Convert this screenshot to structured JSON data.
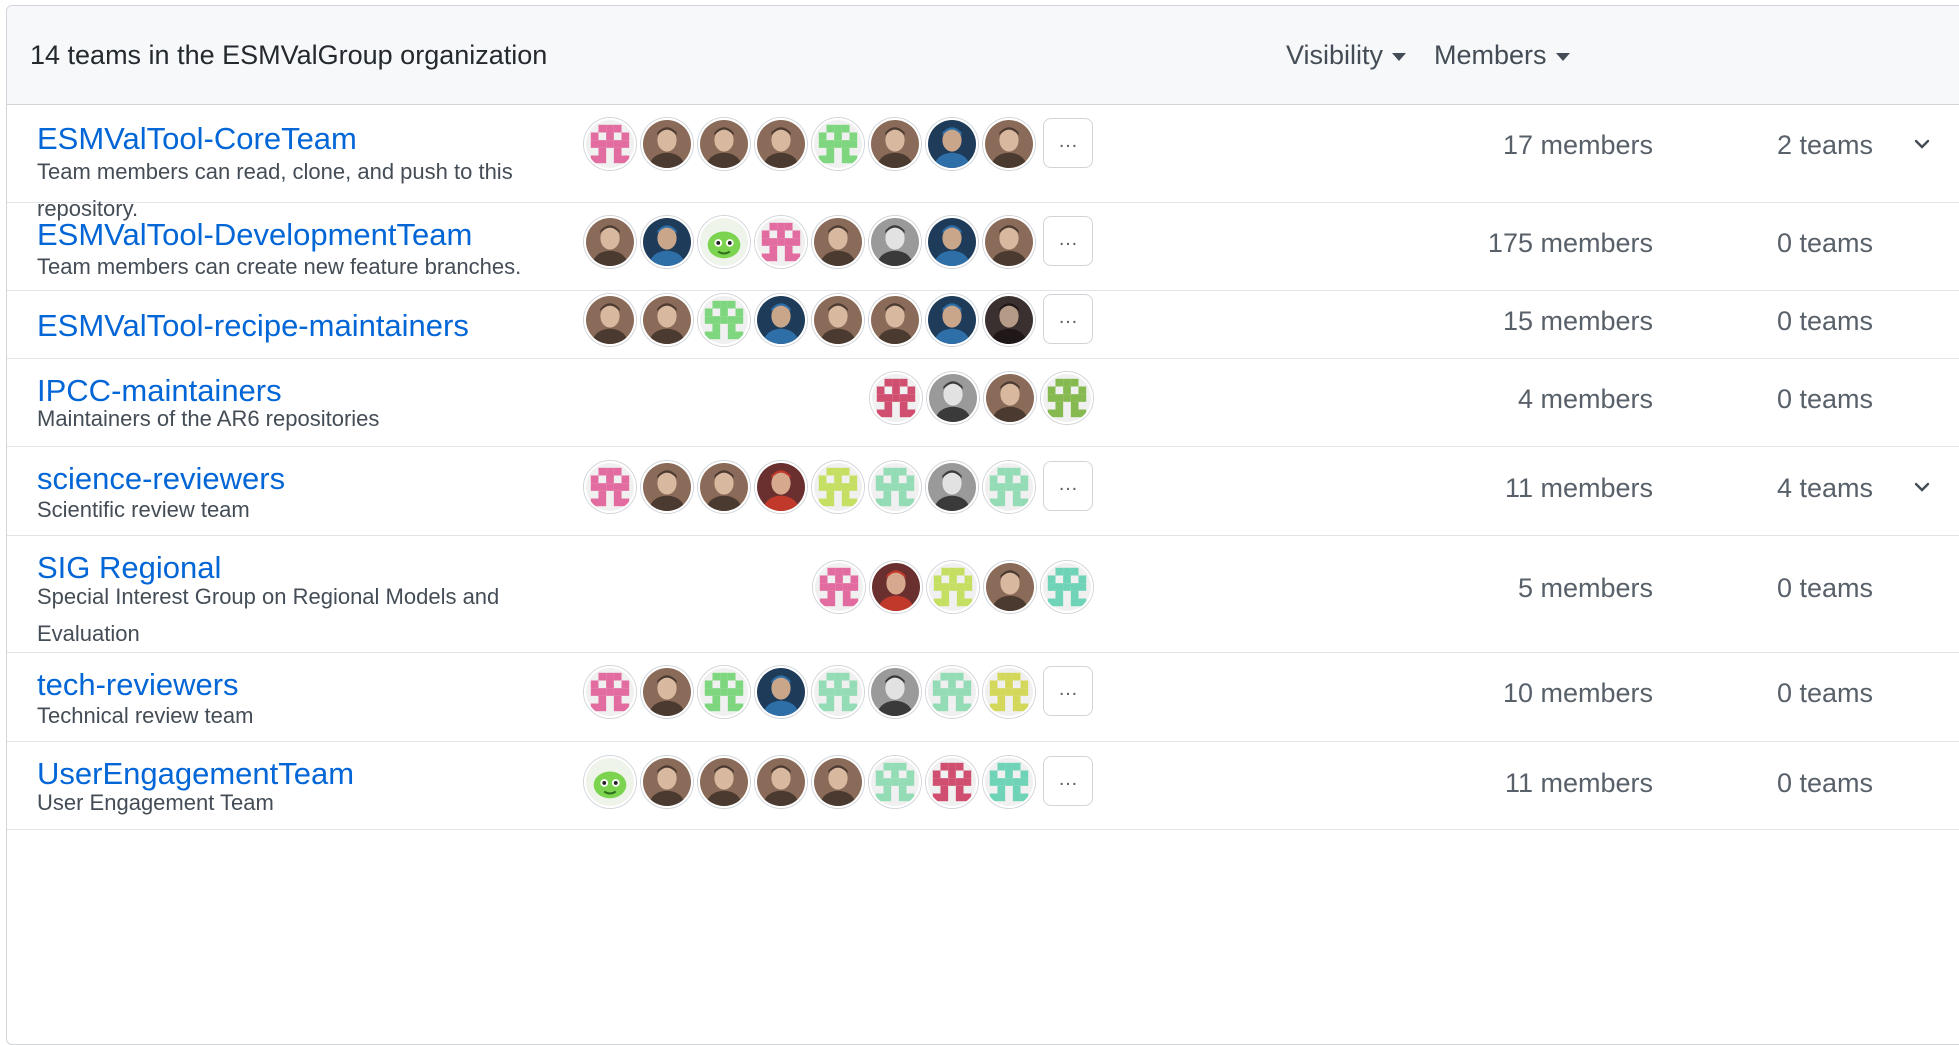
{
  "header": {
    "title": "14 teams in the ESMValGroup organization",
    "visibility_label": "Visibility",
    "members_label": "Members"
  },
  "colors": {
    "link": "#0366d6",
    "muted": "#586069",
    "border": "#d1d5da",
    "header_bg": "#f6f8fa"
  },
  "more_label": "…",
  "teams": [
    {
      "name": "ESMValTool-CoreTeam",
      "description": "Team members can read, clone, and push to this repository.",
      "members": "17 members",
      "teams": "2 teams",
      "expandable": true,
      "avatars": [
        "identicon-pink",
        "photo",
        "photo",
        "photo",
        "identicon-green",
        "photo",
        "photo-blue",
        "photo"
      ],
      "more": true
    },
    {
      "name": "ESMValTool-DevelopmentTeam",
      "description": "Team members can create new feature branches.",
      "members": "175 members",
      "teams": "0 teams",
      "expandable": false,
      "avatars": [
        "photo",
        "photo-blue",
        "cartoon-green",
        "identicon-pink",
        "photo",
        "photo-gray",
        "photo-blue",
        "photo"
      ],
      "more": true
    },
    {
      "name": "ESMValTool-recipe-maintainers",
      "description": "",
      "members": "15 members",
      "teams": "0 teams",
      "expandable": false,
      "avatars": [
        "photo",
        "photo",
        "identicon-green",
        "photo-blue",
        "photo",
        "photo",
        "photo-blue",
        "photo-dark"
      ],
      "more": true
    },
    {
      "name": "IPCC-maintainers",
      "description": "Maintainers of the AR6 repositories",
      "members": "4 members",
      "teams": "0 teams",
      "expandable": false,
      "avatars": [
        "identicon-red",
        "photo-gray",
        "photo",
        "identicon-olive"
      ],
      "more": false
    },
    {
      "name": "science-reviewers",
      "description": "Scientific review team",
      "members": "11 members",
      "teams": "4 teams",
      "expandable": true,
      "avatars": [
        "identicon-pink",
        "photo",
        "photo",
        "photo-red",
        "identicon-lime",
        "identicon-mint",
        "photo-gray",
        "identicon-mint"
      ],
      "more": true
    },
    {
      "name": "SIG Regional",
      "description": "Special Interest Group on Regional Models and Evaluation",
      "members": "5 members",
      "teams": "0 teams",
      "expandable": false,
      "avatars": [
        "identicon-pink",
        "photo-red",
        "identicon-lime",
        "photo",
        "identicon-teal"
      ],
      "more": false
    },
    {
      "name": "tech-reviewers",
      "description": "Technical review team",
      "members": "10 members",
      "teams": "0 teams",
      "expandable": false,
      "avatars": [
        "identicon-pink",
        "photo",
        "identicon-green",
        "photo-blue",
        "identicon-mint",
        "photo-gray",
        "identicon-mint",
        "identicon-yellow"
      ],
      "more": true
    },
    {
      "name": "UserEngagementTeam",
      "description": "User Engagement Team",
      "members": "11 members",
      "teams": "0 teams",
      "expandable": false,
      "avatars": [
        "cartoon-green",
        "photo",
        "photo",
        "photo",
        "photo",
        "identicon-mint",
        "identicon-red",
        "identicon-teal"
      ],
      "more": true
    }
  ]
}
